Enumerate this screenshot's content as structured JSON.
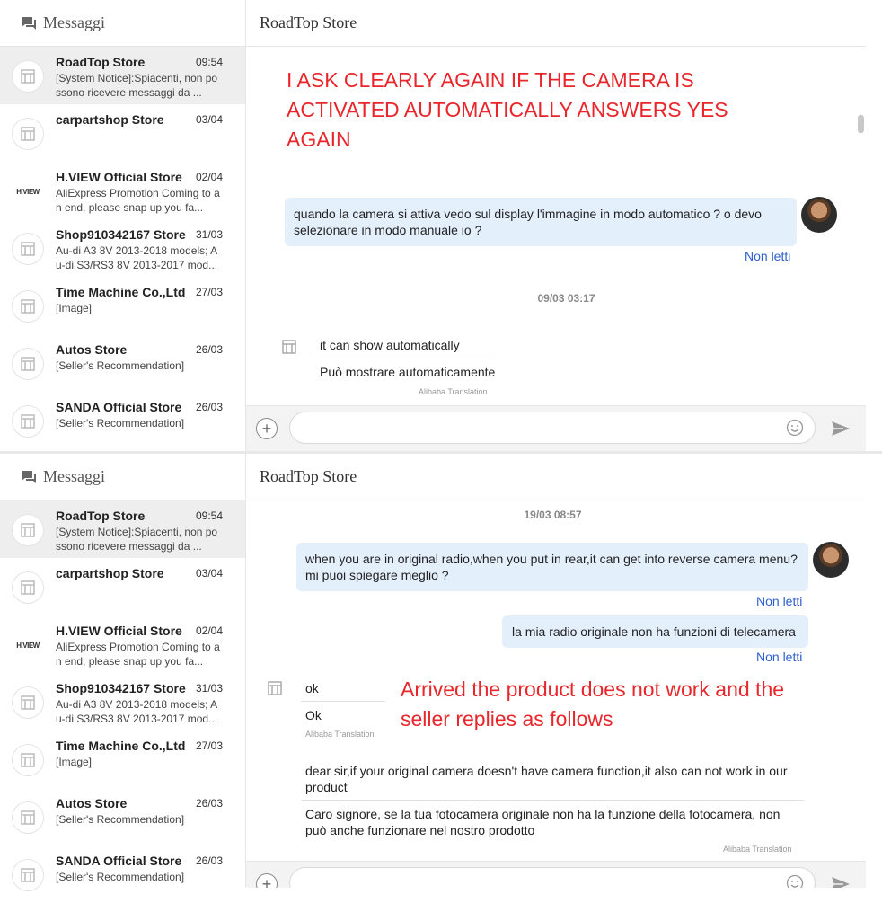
{
  "sidebar": {
    "title": "Messaggi",
    "conversations": [
      {
        "name": "RoadTop Store",
        "time": "09:54",
        "preview": "[System Notice]:Spiacenti, non possono ricevere messaggi da ..."
      },
      {
        "name": "carpartshop Store",
        "time": "03/04",
        "preview": ""
      },
      {
        "name": "H.VIEW Official Store",
        "time": "02/04",
        "preview": "AliExpress Promotion Coming to an end, please snap up you fa...",
        "logo": "H.VIEW"
      },
      {
        "name": "Shop910342167 Store",
        "time": "31/03",
        "preview": "Au-di A3 8V 2013-2018 models; Au-di S3/RS3 8V 2013-2017 mod..."
      },
      {
        "name": "Time Machine Co.,Ltd",
        "time": "27/03",
        "preview": "[Image]"
      },
      {
        "name": "Autos Store",
        "time": "26/03",
        "preview": "[Seller's Recommendation]"
      },
      {
        "name": "SANDA Official Store",
        "time": "26/03",
        "preview": "[Seller's Recommendation]"
      }
    ]
  },
  "chat": {
    "title": "RoadTop Store"
  },
  "panel1": {
    "annotation": "I ASK CLEARLY AGAIN IF THE CAMERA IS ACTIVATED AUTOMATICALLY ANSWERS YES AGAIN",
    "user_msg": "quando la camera si attiva vedo sul display l'immagine in modo automatico ? o devo selezionare in modo manuale io ?",
    "unread": "Non letti",
    "timestamp": "09/03 03:17",
    "seller_msg": "it can show automatically",
    "seller_translation": "Può mostrare automaticamente",
    "translation_label": "Alibaba Translation"
  },
  "panel2": {
    "timestamp": "19/03 08:57",
    "user_msg1": "when you are in original radio,when you put in rear,it can get into reverse camera menu? mi puoi spiegare meglio ?",
    "unread1": "Non letti",
    "user_msg2": "la mia radio originale non ha funzioni di telecamera",
    "unread2": "Non letti",
    "seller_msg1": "ok",
    "seller_msg1_translation": "Ok",
    "translation_label": "Alibaba Translation",
    "annotation": "Arrived the product does not work and the seller replies as follows",
    "seller_msg2": "dear sir,if your original camera doesn't have camera function,it also can not work in our product",
    "seller_msg2_translation": "Caro signore, se la tua fotocamera originale non ha la funzione della fotocamera, non può anche funzionare nel nostro prodotto",
    "translation_label2": "Alibaba Translation"
  },
  "colors": {
    "bubble": "#e4effc",
    "link": "#2c5fcf",
    "annotation": "#e8262b"
  }
}
